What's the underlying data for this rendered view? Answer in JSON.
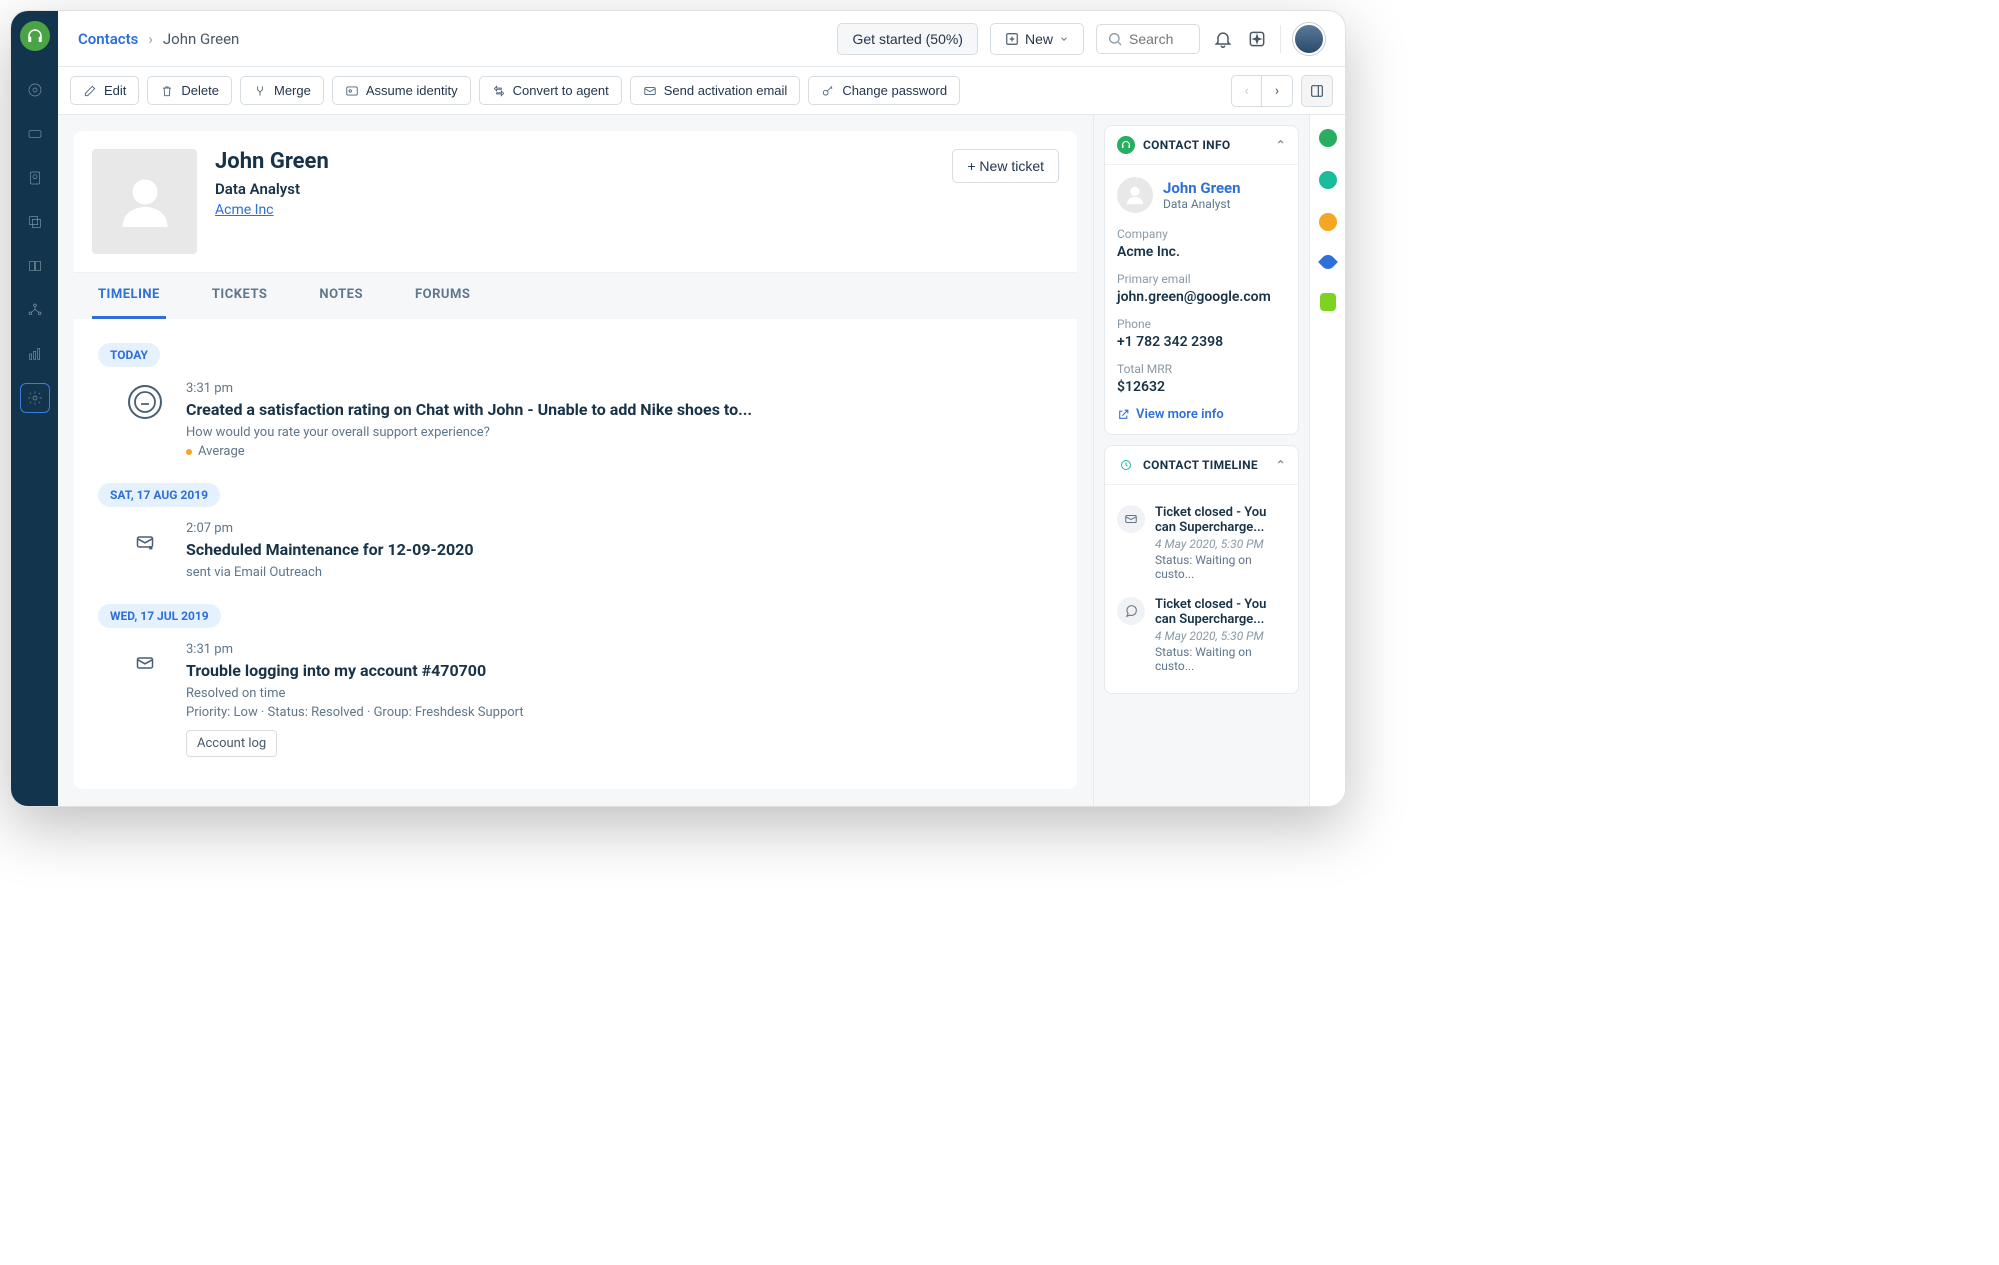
{
  "breadcrumb": {
    "root": "Contacts",
    "current": "John Green"
  },
  "header": {
    "get_started": "Get started (50%)",
    "new_label": "New",
    "search_placeholder": "Search"
  },
  "toolbar": {
    "edit": "Edit",
    "delete": "Delete",
    "merge": "Merge",
    "assume": "Assume identity",
    "convert": "Convert to agent",
    "activation": "Send activation email",
    "password": "Change password"
  },
  "profile": {
    "name": "John Green",
    "role": "Data Analyst",
    "company": "Acme Inc",
    "new_ticket": "+ New ticket"
  },
  "tabs": [
    "TIMELINE",
    "TICKETS",
    "NOTES",
    "FORUMS"
  ],
  "timeline": [
    {
      "date": "TODAY",
      "items": [
        {
          "icon": "face",
          "time": "3:31 pm",
          "title": "Created a satisfaction rating on Chat with John - Unable to add Nike shoes to...",
          "sub": "How would you rate your overall support experience?",
          "rating": "Average"
        }
      ]
    },
    {
      "date": "SAT, 17 AUG 2019",
      "items": [
        {
          "icon": "mail-out",
          "time": "2:07 pm",
          "title": "Scheduled Maintenance for 12-09-2020",
          "sub": "sent via Email Outreach"
        }
      ]
    },
    {
      "date": "WED, 17 JUL 2019",
      "items": [
        {
          "icon": "mail",
          "time": "3:31 pm",
          "title": "Trouble logging into my account #470700",
          "meta": "Priority: Low  ·  Status: Resolved  ·  Group: Freshdesk Support",
          "sub": "Resolved on time",
          "chip": "Account log"
        }
      ]
    }
  ],
  "contact_info": {
    "header": "CONTACT INFO",
    "name": "John Green",
    "role": "Data Analyst",
    "fields": [
      {
        "label": "Company",
        "value": "Acme Inc."
      },
      {
        "label": "Primary email",
        "value": "john.green@google.com"
      },
      {
        "label": "Phone",
        "value": "+1 782 342 2398"
      },
      {
        "label": "Total MRR",
        "value": "$12632"
      }
    ],
    "view_more": "View more info"
  },
  "contact_timeline": {
    "header": "CONTACT TIMELINE",
    "items": [
      {
        "icon": "mail",
        "title": "Ticket closed - You can Supercharge...",
        "date": "4 May 2020, 5:30 PM",
        "status": "Status: Waiting on custo..."
      },
      {
        "icon": "chat",
        "title": "Ticket closed - You can Supercharge...",
        "date": "4 May 2020, 5:30 PM",
        "status": "Status: Waiting on custo..."
      }
    ]
  }
}
